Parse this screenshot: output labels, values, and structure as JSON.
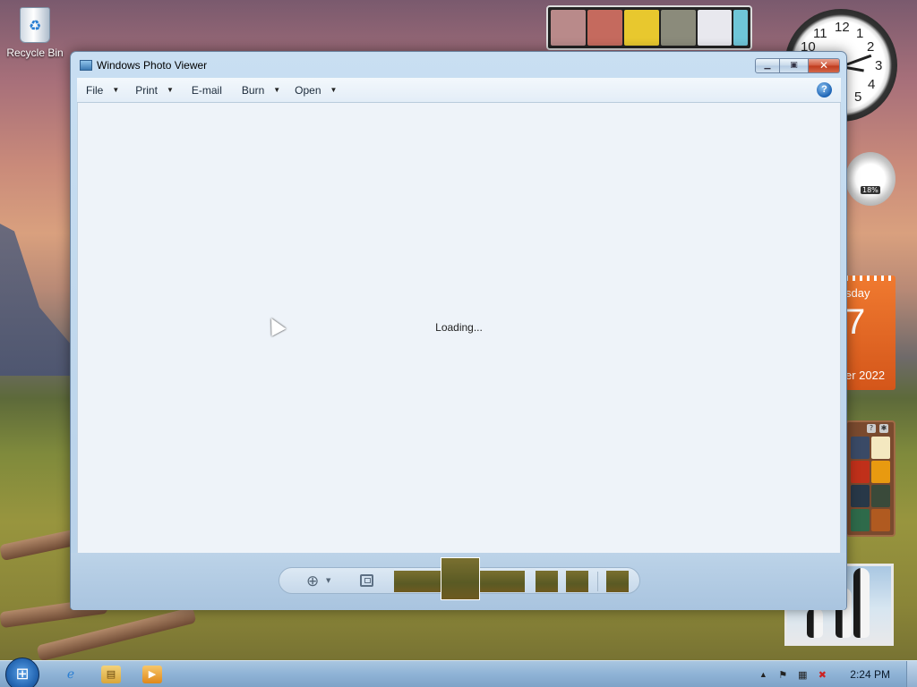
{
  "desktop": {
    "recycle_bin_label": "Recycle Bin"
  },
  "gadgets": {
    "cpu_meter_value": "18%",
    "calendar_day_partial": "sday",
    "calendar_day_number": "7",
    "calendar_month_year_partial": "er 2022",
    "clock_numbers": [
      "12",
      "1",
      "2",
      "3",
      "4",
      "5",
      "10",
      "11"
    ]
  },
  "window": {
    "title": "Windows Photo Viewer",
    "menu": [
      {
        "label": "File",
        "has_dropdown": true
      },
      {
        "label": "Print",
        "has_dropdown": true
      },
      {
        "label": "E-mail",
        "has_dropdown": false
      },
      {
        "label": "Burn",
        "has_dropdown": true
      },
      {
        "label": "Open",
        "has_dropdown": true
      }
    ],
    "status_text": "Loading...",
    "controls": {
      "zoom_icon": "magnifier-plus-icon",
      "fit_icon": "actual-size-icon"
    }
  },
  "taskbar": {
    "clock": "2:24 PM",
    "pinned": [
      "internet-explorer-icon",
      "windows-explorer-icon",
      "media-player-icon"
    ],
    "tray_icons": [
      "show-hidden-icons-arrow",
      "action-center-flag-icon",
      "network-icon",
      "volume-muted-icon"
    ]
  },
  "colors": {
    "window_frame": "#c9dff2",
    "viewer_bg": "#eef3f9",
    "close_button": "#c8452a",
    "taskbar": "#8fb3d6"
  }
}
